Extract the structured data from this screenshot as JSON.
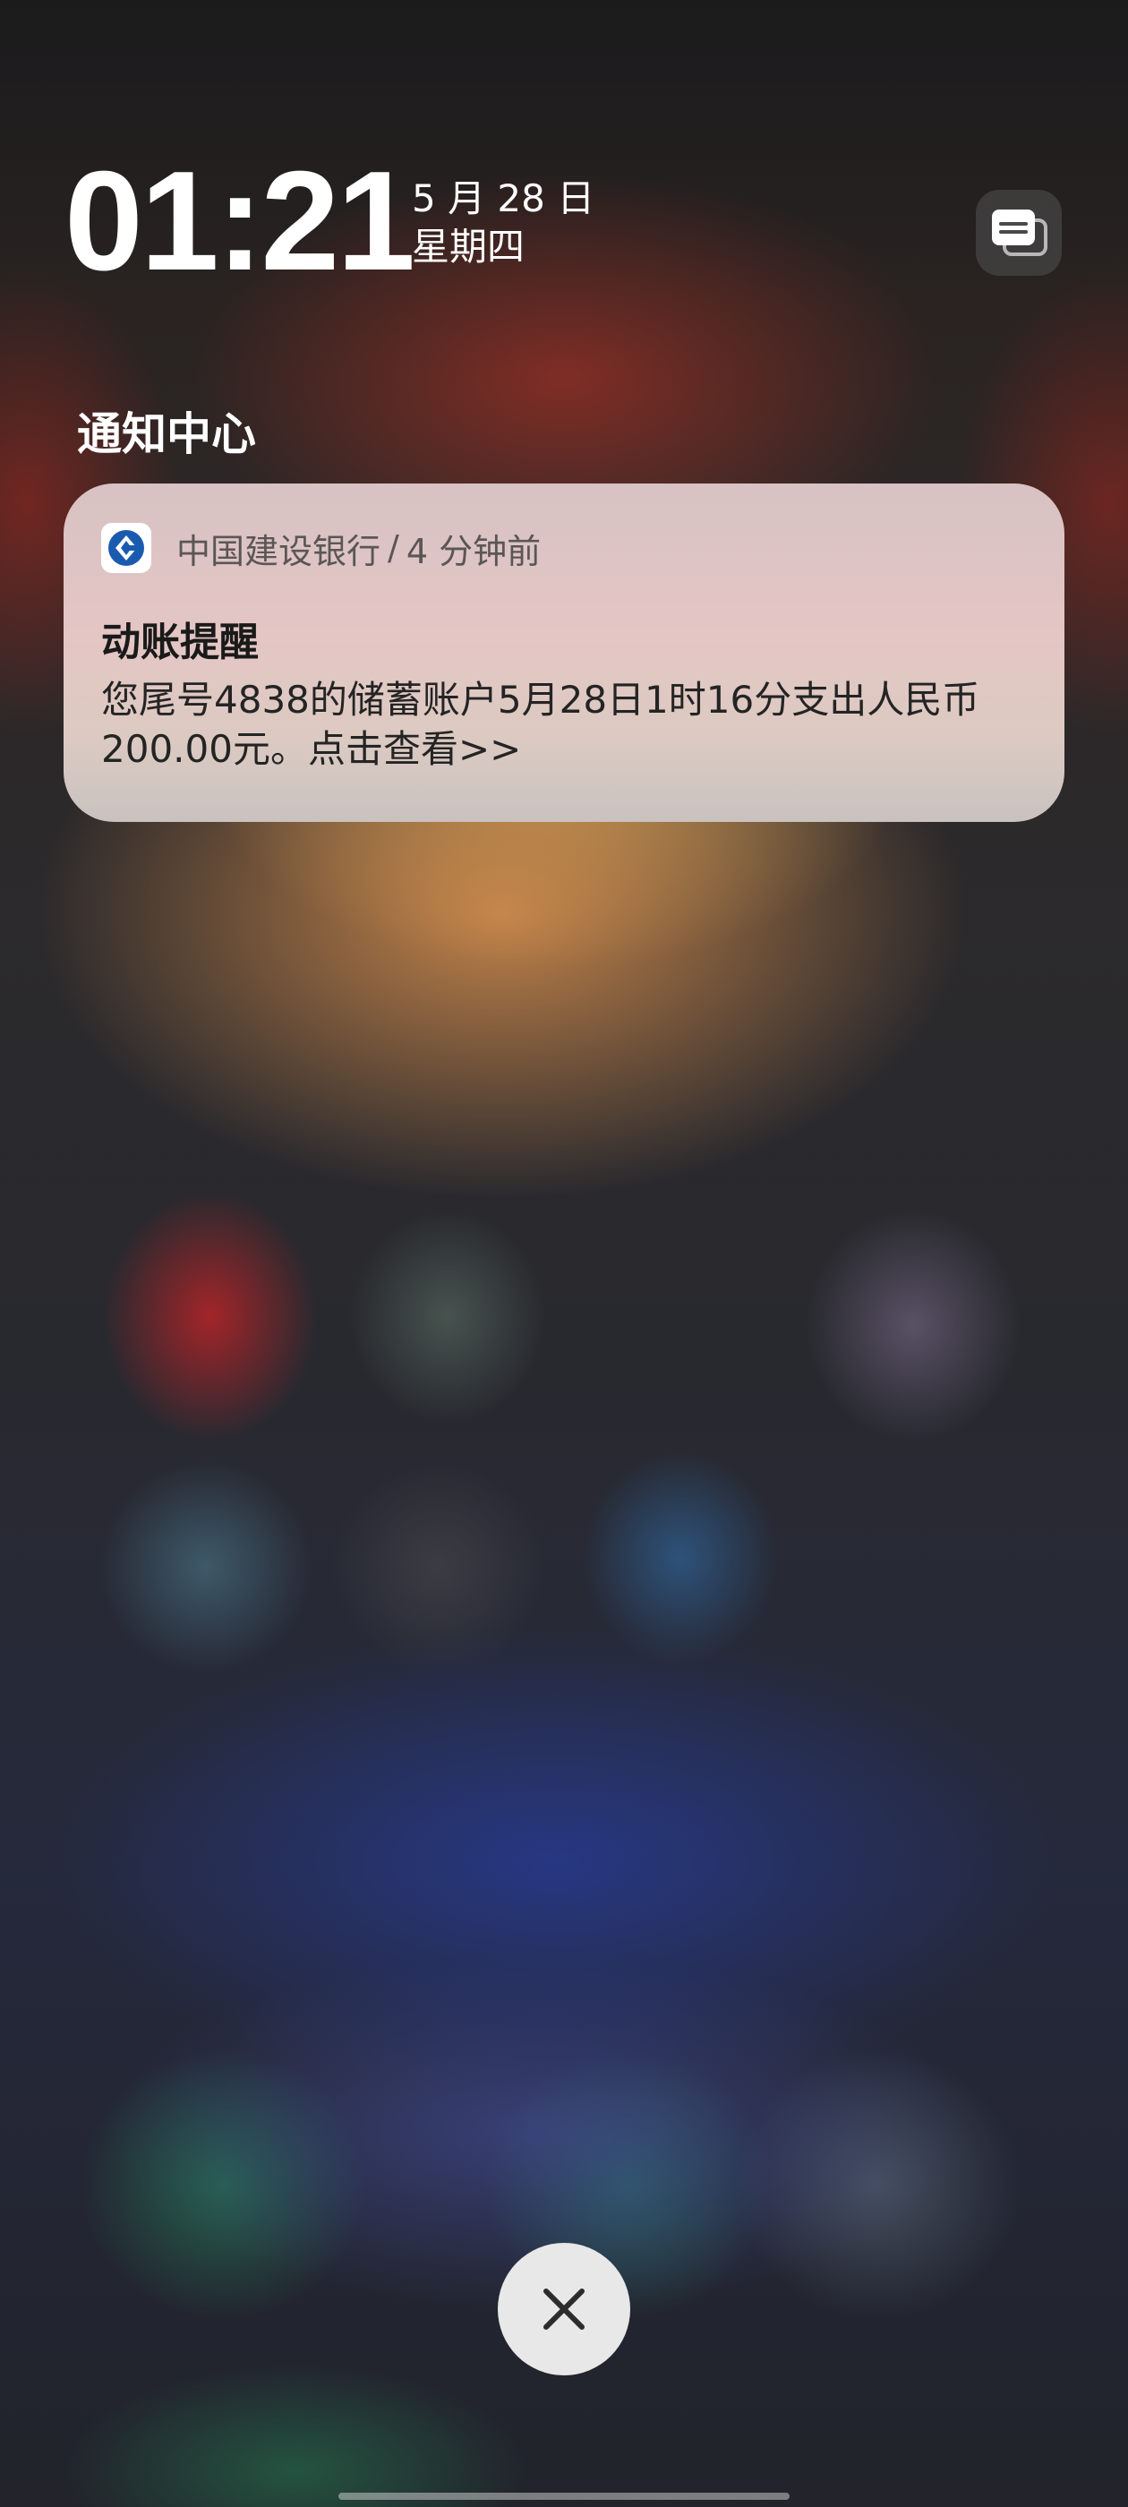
{
  "lock_screen": {
    "time": "01:21",
    "date": "5 月 28 日",
    "weekday": "星期四"
  },
  "notification_center": {
    "title": "通知中心"
  },
  "notification": {
    "app_name": "中国建设银行",
    "separator": "/",
    "time_ago": "4 分钟前",
    "title": "动账提醒",
    "body": "您尾号4838的储蓄账户5月28日1时16分支出人民币200.00元。点击查看>>",
    "app_icon": "ccb-logo-icon",
    "brand_color": "#1a5bb0"
  },
  "controls": {
    "stack_icon": "notification-stack-icon",
    "close_icon": "close-icon"
  }
}
